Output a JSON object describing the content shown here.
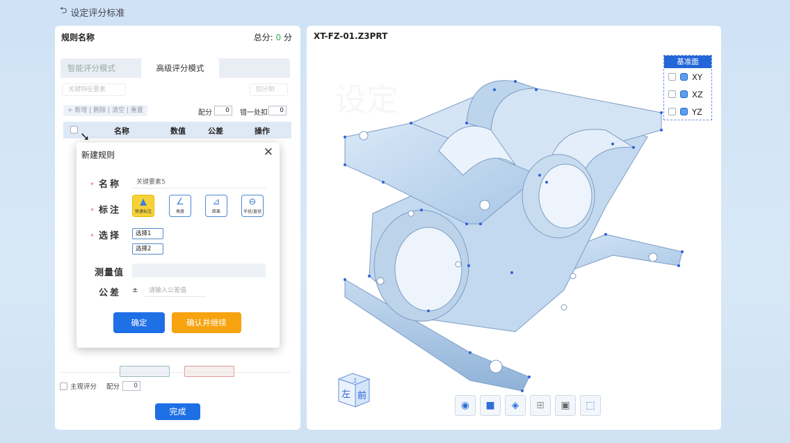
{
  "header": {
    "back_label": "设定评分标准",
    "back_icon": "undo-arrow-icon"
  },
  "left": {
    "title": "规则名称",
    "score_label": "总分:",
    "score_value": "0",
    "score_unit": "分",
    "tabs": [
      {
        "label": "智能评分模式"
      },
      {
        "label": "高级评分模式"
      }
    ],
    "feature_select": "关键特征要素",
    "deduct_select": "扣分制",
    "toolbar": {
      "new": "+ 新增",
      "delete": "删除",
      "clear": "清空",
      "reset": "重置"
    },
    "points_label": "配分",
    "points_value": "0",
    "per_deduct_label": "错一处扣",
    "per_deduct_value": "0",
    "table_headers": [
      "名称",
      "数值",
      "公差",
      "操作"
    ],
    "subjective_label": "主观评分",
    "subjective_points_label": "配分",
    "subjective_points_value": "0",
    "done_button": "完成"
  },
  "dialog": {
    "title": "新建规则",
    "name_label": "名称",
    "name_value": "关键要素5",
    "mark_label": "标注",
    "mark_buttons": [
      {
        "icon": "quick-mark-icon",
        "label": "快速标注"
      },
      {
        "icon": "angle-icon",
        "label": "角度"
      },
      {
        "icon": "distance-icon",
        "label": "距离"
      },
      {
        "icon": "radius-icon",
        "label": "半径/直径"
      }
    ],
    "select_label": "选择",
    "options": [
      "选择1",
      "选择2"
    ],
    "measure_label": "测量值",
    "tolerance_label": "公差",
    "tolerance_sign": "±",
    "tolerance_placeholder": "请输入公差值",
    "confirm_button": "确定",
    "confirm_continue_button": "确认并继续"
  },
  "right": {
    "title": "XT-FZ-01.Z3PRT",
    "datum": {
      "title": "基准面",
      "planes": [
        "XY",
        "XZ",
        "YZ"
      ]
    },
    "view_cube": {
      "front": "前",
      "left": "左",
      "top": "上"
    },
    "toolbar_icons": [
      "eye-icon",
      "view-icon",
      "section-icon",
      "add-box-icon",
      "dark-box-icon",
      "axis-box-icon"
    ]
  },
  "colors": {
    "primary": "#1f6fe5",
    "orange": "#f7a310",
    "model": "#bed6ee",
    "point": "#2f62d8"
  }
}
